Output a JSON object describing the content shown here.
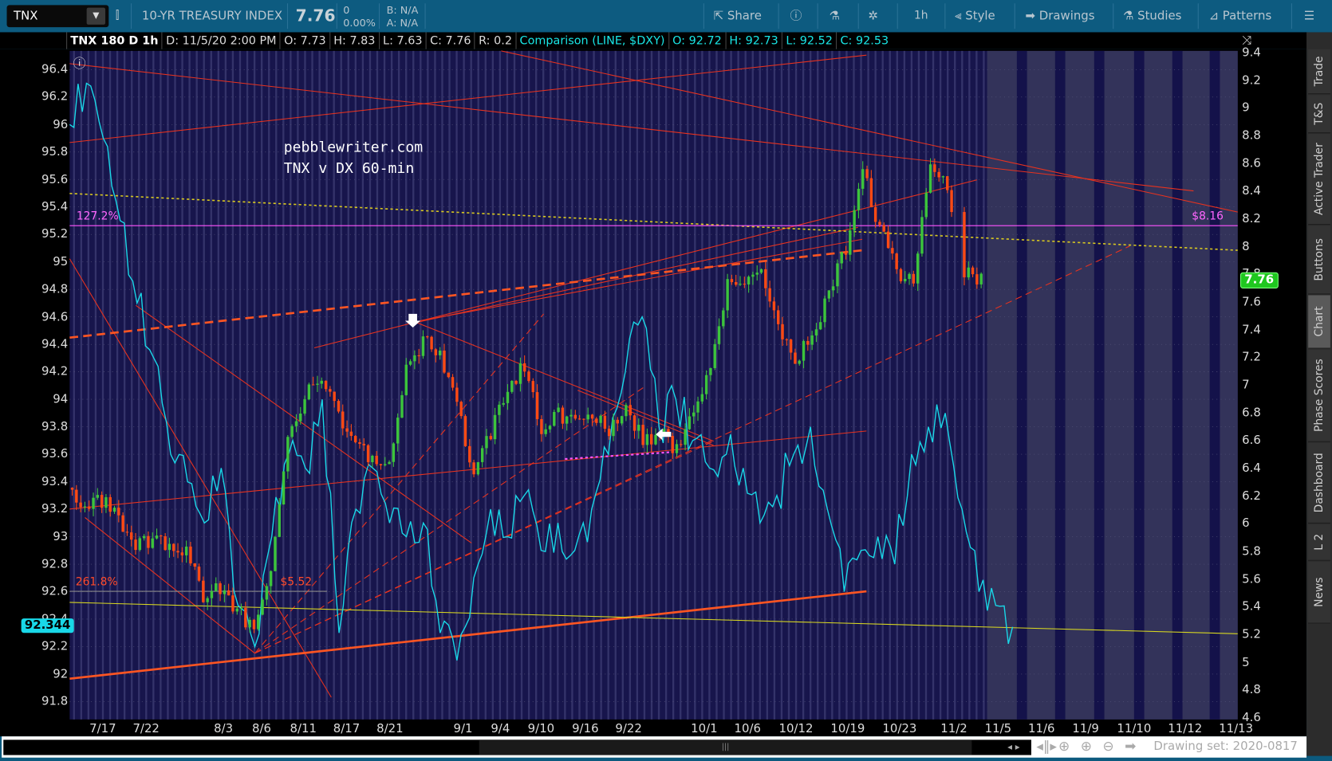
{
  "toolbar": {
    "symbol": "TNX",
    "description": "10-YR TREASURY INDEX",
    "last": "7.76",
    "change": "0",
    "change_pct": "0.00%",
    "bid": "B: N/A",
    "ask": "A: N/A",
    "buttons": [
      {
        "label": "Share",
        "icon": "share-icon"
      },
      {
        "label": "",
        "icon": "info-icon"
      },
      {
        "label": "",
        "icon": "flask-icon"
      },
      {
        "label": "",
        "icon": "gear-icon"
      },
      {
        "label": "1h",
        "icon": ""
      },
      {
        "label": "Style",
        "icon": "candle-icon"
      },
      {
        "label": "Drawings",
        "icon": "arrow-right-icon"
      },
      {
        "label": "Studies",
        "icon": "flask-icon"
      },
      {
        "label": "Patterns",
        "icon": "patterns-icon"
      },
      {
        "label": "",
        "icon": "menu-icon"
      }
    ]
  },
  "infobar": {
    "title": "TNX 180 D 1h",
    "date": "D: 11/5/20 2:00 PM",
    "open": "O: 7.73",
    "high": "H: 7.83",
    "low": "L: 7.63",
    "close": "C: 7.76",
    "range": "R: 0.2",
    "comparison": "Comparison (LINE, $DXY)",
    "cmp_open": "O: 92.72",
    "cmp_high": "H: 92.73",
    "cmp_low": "L: 92.52",
    "cmp_close": "C: 92.53"
  },
  "watermark": {
    "line1": "pebblewriter.com",
    "line2": "TNX v DX 60-min"
  },
  "annotations": {
    "fib_127": "127.2%",
    "price_816": "$8.16",
    "fib_261": "261.8%",
    "price_552": "$5.52"
  },
  "badges": {
    "dxy_last": "92.344",
    "tnx_last": "7.76"
  },
  "sidebar": {
    "tabs": [
      "Trade",
      "T&S",
      "Active Trader",
      "Buttons",
      "Chart",
      "Phase Scores",
      "Dashboard",
      "L 2",
      "News"
    ],
    "selected": "Chart"
  },
  "footer": {
    "drawing_set": "Drawing set: 2020-0817"
  },
  "colors": {
    "toolbar": "#0d5b80",
    "chart_bg": "#17154c",
    "up": "#3cc43c",
    "down": "#ff4a14",
    "dxy": "#19d8e8",
    "fib": "#ff55ff"
  },
  "chart_data": {
    "type": "line",
    "title": "TNX 180 D 1h",
    "left_axis": {
      "label": "$DXY",
      "ticks": [
        "96.4",
        "96.2",
        "96",
        "95.8",
        "95.6",
        "95.4",
        "95.2",
        "95",
        "94.8",
        "94.6",
        "94.4",
        "94.2",
        "94",
        "93.8",
        "93.6",
        "93.4",
        "93.2",
        "93",
        "92.8",
        "92.6",
        "92.4",
        "92.2",
        "92",
        "91.8"
      ],
      "range": [
        91.8,
        96.4
      ]
    },
    "right_axis": {
      "label": "TNX",
      "ticks": [
        "9.4",
        "9.2",
        "9",
        "8.8",
        "8.6",
        "8.4",
        "8.2",
        "8",
        "7.8",
        "7.6",
        "7.4",
        "7.2",
        "7",
        "6.8",
        "6.6",
        "6.4",
        "6.2",
        "6",
        "5.8",
        "5.6",
        "5.4",
        "5.2",
        "5",
        "4.8",
        "4.6"
      ],
      "range": [
        4.6,
        9.4
      ]
    },
    "x_ticks": [
      "7/17",
      "7/22",
      "8/3",
      "8/6",
      "8/11",
      "8/17",
      "8/21",
      "9/1",
      "9/4",
      "9/10",
      "9/16",
      "9/22",
      "10/1",
      "10/6",
      "10/12",
      "10/19",
      "10/23",
      "11/2",
      "11/5",
      "11/6",
      "11/9",
      "11/10",
      "11/12",
      "11/13"
    ],
    "series": [
      {
        "name": "TNX",
        "style": "candles",
        "axis": "right",
        "values": [
          6.26,
          6.14,
          6.17,
          6.02,
          5.86,
          5.89,
          5.86,
          5.8,
          5.49,
          5.55,
          5.37,
          5.25,
          5.62,
          6.6,
          6.9,
          7.09,
          6.78,
          6.6,
          6.47,
          6.41,
          7.09,
          7.33,
          7.21,
          6.84,
          6.35,
          6.66,
          6.96,
          7.15,
          6.66,
          6.78,
          6.72,
          6.78,
          6.66,
          6.84,
          6.6,
          6.66,
          6.53,
          6.84,
          7.09,
          7.76,
          7.7,
          7.82,
          7.45,
          7.15,
          7.39,
          7.64,
          8.0,
          8.55,
          8.13,
          7.82,
          7.76,
          8.55,
          8.43,
          7.82,
          7.76
        ]
      },
      {
        "name": "$DXY",
        "style": "line",
        "axis": "left",
        "values": [
          96.0,
          96.3,
          95.9,
          95.3,
          94.7,
          94.3,
          93.6,
          93.4,
          93.1,
          93.5,
          92.5,
          92.2,
          93.0,
          93.6,
          93.5,
          94.0,
          92.3,
          93.2,
          93.5,
          93.1,
          93.0,
          93.1,
          92.3,
          92.1,
          92.7,
          93.2,
          93.0,
          93.3,
          92.9,
          93.1,
          92.9,
          93.2,
          93.6,
          94.2,
          94.6,
          93.8,
          94.0,
          93.7,
          93.5,
          93.6,
          93.5,
          93.1,
          93.3,
          93.6,
          93.8,
          93.2,
          92.6,
          92.9,
          93.0,
          92.8,
          93.6,
          93.8,
          93.9,
          93.2,
          92.6,
          92.5,
          92.344
        ]
      }
    ],
    "levels": [
      {
        "label": "127.2%",
        "value": 8.16,
        "axis": "right"
      },
      {
        "label": "261.8%",
        "value": 5.52,
        "axis": "right"
      }
    ]
  }
}
